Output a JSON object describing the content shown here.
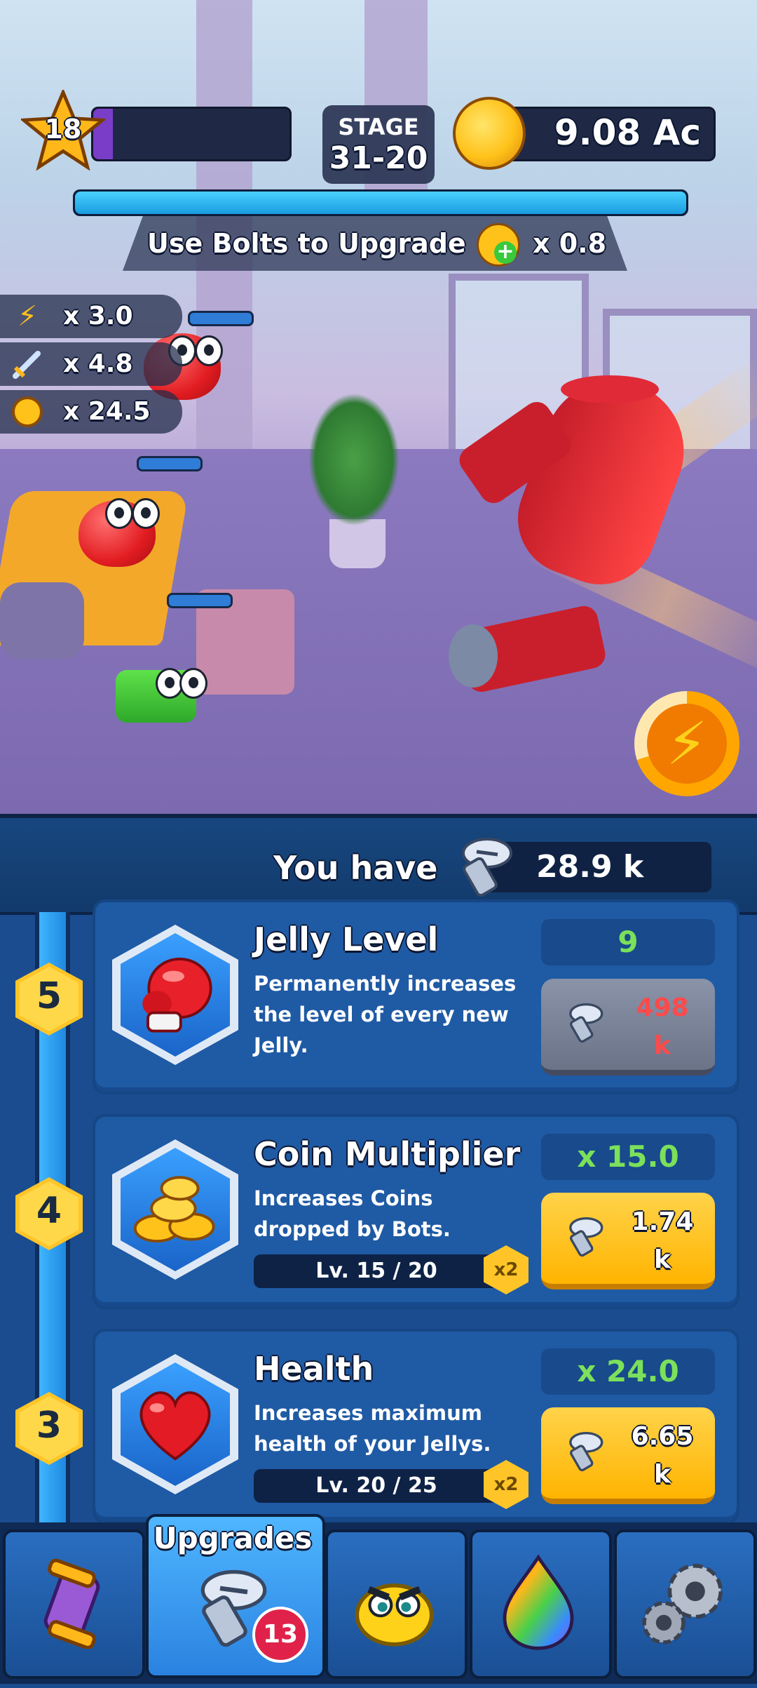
{
  "hud": {
    "player_level": "18",
    "stage_label": "STAGE",
    "stage_value": "31-20",
    "coins": "9.08 Ac",
    "level_progress": 0.1,
    "stage_progress": 1.0,
    "banner_text": "Use Bolts to Upgrade",
    "bolt_bonus": "x 0.8"
  },
  "multipliers": [
    {
      "icon": "lightning-icon",
      "value": "x 3.0"
    },
    {
      "icon": "sword-icon",
      "value": "x 4.8"
    },
    {
      "icon": "coin-icon",
      "value": "x 24.5"
    }
  ],
  "panel": {
    "have_label": "You have",
    "bolts": "28.9 k"
  },
  "upgrades": [
    {
      "rank": "5",
      "icon": "boxing-glove-icon",
      "title": "Jelly Level",
      "desc": "Permanently increases the level of every new Jelly.",
      "value": "9",
      "price_top": "498",
      "price_bottom": "k",
      "state": "locked",
      "level": ""
    },
    {
      "rank": "4",
      "icon": "coins-stack-icon",
      "title": "Coin Multiplier",
      "desc": "Increases Coins dropped by Bots.",
      "value": "x 15.0",
      "price_top": "1.74",
      "price_bottom": "k",
      "state": "available",
      "level": "Lv. 15 / 20",
      "boost": "x2",
      "level_progress": 0.75
    },
    {
      "rank": "3",
      "icon": "heart-icon",
      "title": "Health",
      "desc": "Increases maximum health of your Jellys.",
      "value": "x 24.0",
      "price_top": "6.65",
      "price_bottom": "k",
      "state": "available",
      "level": "Lv. 20 / 25",
      "boost": "x2",
      "level_progress": 0.8
    }
  ],
  "nav": {
    "active": "Upgrades",
    "upgrades_label": "Upgrades",
    "upgrades_badge": "13",
    "items": [
      "capsule-icon",
      "bolt-icon",
      "jelly-face-icon",
      "rainbow-drop-icon",
      "gears-icon"
    ]
  },
  "colors": {
    "accent_gold": "#ffc21a",
    "value_green": "#7be05a",
    "price_red": "#ff4a4a",
    "panel_blue": "#1a4c8f"
  }
}
